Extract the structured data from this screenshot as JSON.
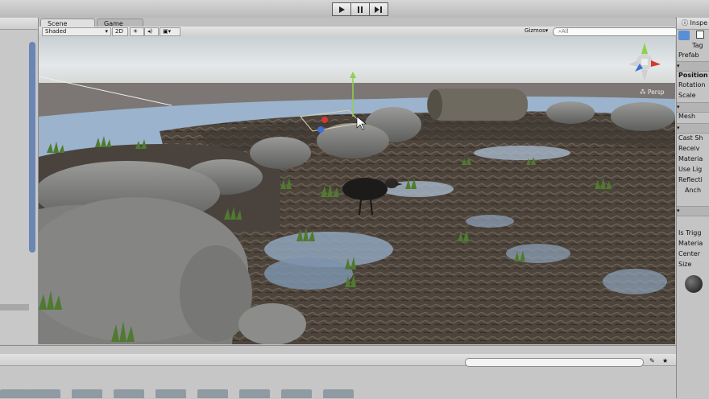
{
  "toolbar": {
    "play_icon": "play-icon",
    "pause_icon": "pause-icon",
    "step_icon": "step-icon"
  },
  "tabs": {
    "scene": "Scene",
    "game": "Game"
  },
  "scene_toolbar": {
    "shading": "Shaded",
    "mode_2d": "2D",
    "gizmos": "Gizmos",
    "search_placeholder": "All",
    "persp": "Persp"
  },
  "inspector": {
    "title": "Inspe",
    "tag_label": "Tag",
    "prefab_label": "Prefab",
    "transform_rows": [
      "Position",
      "Rotation",
      "Scale"
    ],
    "mesh_label": "Mesh",
    "renderer_rows": [
      "Cast Sh",
      "Receiv",
      "Materia",
      "Use Lig",
      "Reflecti",
      "Anch"
    ],
    "collider_rows": [
      "Is Trigg",
      "Materia",
      "Center",
      "Size"
    ]
  },
  "colors": {
    "accent_blue": "#6b85b5",
    "water": "#9bb3cc",
    "sky": "#dde3e6"
  }
}
